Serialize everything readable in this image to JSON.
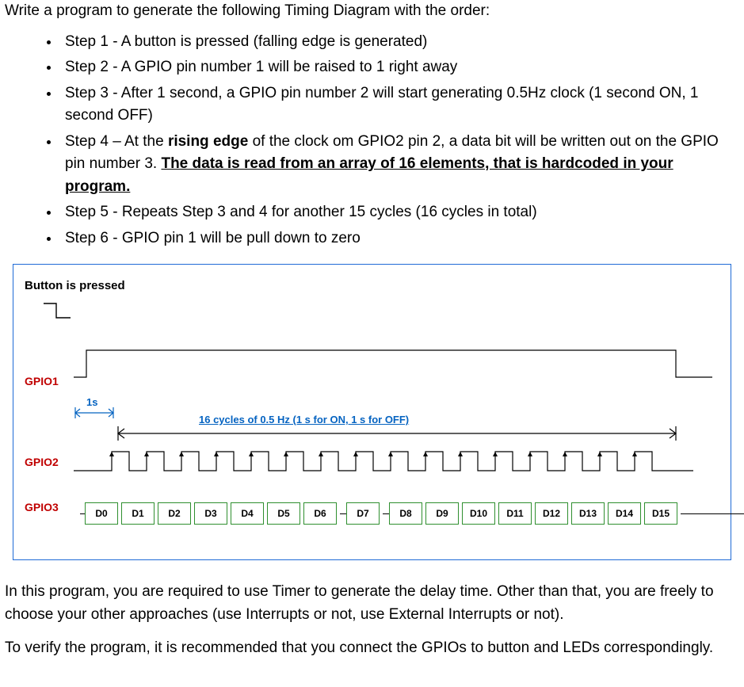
{
  "intro": "Write a program to generate the following Timing Diagram with the order:",
  "steps": {
    "s1": "Step 1 - A button is pressed (falling edge is generated)",
    "s2": "Step 2 - A GPIO pin number 1 will be raised to 1 right away",
    "s3": "Step 3 - After 1 second, a GPIO pin number 2 will start generating 0.5Hz clock (1 second ON, 1 second OFF)",
    "s4_a": "Step 4 – At the ",
    "s4_b": "rising edge",
    "s4_c": " of the clock om GPIO2 pin 2, a data bit will be written out on the GPIO pin number 3. ",
    "s4_d": "The data is read from an array of 16 elements, that is hardcoded in your program.",
    "s5": "Step 5 - Repeats Step 3 and 4 for another 15 cycles (16 cycles in total)",
    "s6": "Step 6 - GPIO pin 1 will be pull down to zero"
  },
  "diagram": {
    "title": "Button is pressed",
    "labels": {
      "gpio1": "GPIO1",
      "gpio2": "GPIO2",
      "gpio3": "GPIO3"
    },
    "annot_1s": "1s",
    "annot_cycles": "16 cycles of 0.5 Hz (1 s for ON, 1 s for OFF)",
    "data": [
      "D0",
      "D1",
      "D2",
      "D3",
      "D4",
      "D5",
      "D6",
      "D7",
      "D8",
      "D9",
      "D10",
      "D11",
      "D12",
      "D13",
      "D14",
      "D15"
    ]
  },
  "post1": "In this program, you are required to use Timer to generate the delay time. Other than that, you are freely to choose your other approaches (use Interrupts or not, use External Interrupts or not).",
  "post2": "To verify the program, it is recommended that you connect the GPIOs to button and LEDs correspondingly.",
  "chart_data": {
    "type": "timing_diagram",
    "signals": [
      {
        "name": "Button",
        "description": "High then falling edge at t=0"
      },
      {
        "name": "GPIO1",
        "description": "Goes high at button press, held high for ~33s (1s delay + 16 clock periods), then low"
      },
      {
        "name": "GPIO2",
        "description": "0.5 Hz square wave, 16 cycles, starting 1s after GPIO1 rising edge, 1s high / 1s low"
      },
      {
        "name": "GPIO3",
        "description": "16 data bits D0..D15, each updated on rising edge of GPIO2"
      }
    ],
    "clock_freq_hz": 0.5,
    "clock_cycles": 16,
    "initial_delay_s": 1,
    "data_bits": [
      "D0",
      "D1",
      "D2",
      "D3",
      "D4",
      "D5",
      "D6",
      "D7",
      "D8",
      "D9",
      "D10",
      "D11",
      "D12",
      "D13",
      "D14",
      "D15"
    ]
  }
}
